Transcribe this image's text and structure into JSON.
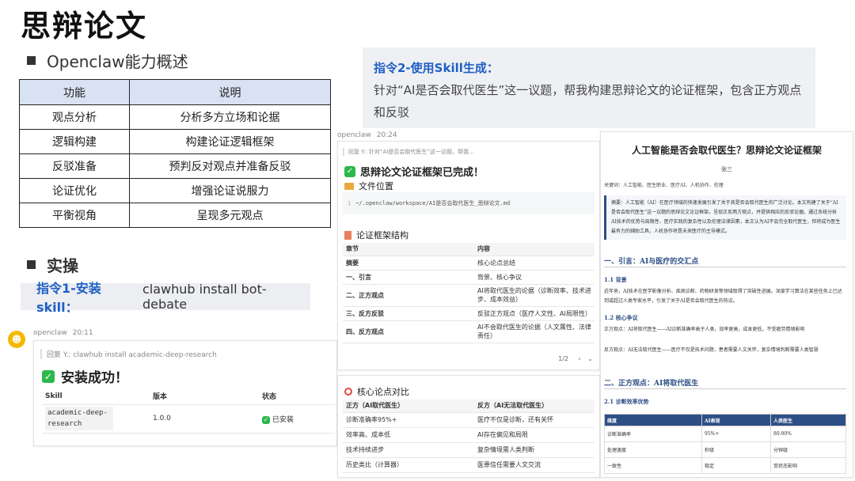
{
  "page_title": "思辩论文",
  "section1_title": "Openclaw能力概述",
  "cap_table": {
    "headers": [
      "功能",
      "说明"
    ],
    "rows": [
      [
        "观点分析",
        "分析多方立场和论据"
      ],
      [
        "逻辑构建",
        "构建论证逻辑框架"
      ],
      [
        "反驳准备",
        "预判反对观点并准备反驳"
      ],
      [
        "论证优化",
        "增强论证说服力"
      ],
      [
        "平衡视角",
        "呈现多元观点"
      ]
    ]
  },
  "section2_title": "实操",
  "cmd1": {
    "label": "指令1-安装skill：",
    "command": "clawhub install bot-debate"
  },
  "cmd2": {
    "label": "指令2-使用Skill生成：",
    "text": "针对“AI是否会取代医生”这一议题，帮我构建思辩论文的论证框架，包含正方观点和反驳"
  },
  "chat1": {
    "sender": "openclaw",
    "time": "20:11",
    "reply": "回复 Y.: clawhub install academic-deep-research",
    "success": "安装成功！",
    "headers": [
      "Skill",
      "版本",
      "状态"
    ],
    "skill": "academic-deep-research",
    "version": "1.0.0",
    "status": "已安装"
  },
  "chat2": {
    "sender": "openclaw",
    "time": "20:24",
    "reply": "回复 Y.: 针对“AI是否会取代医生”这一议题，帮我...",
    "done": "思辩论文论证框架已完成！",
    "file_heading": "文件位置",
    "line_no": "1",
    "file_path": "~/.openclaw/workspace/AI是否会取代医生_思辩论文.md",
    "struct_heading": "论证框架结构",
    "struct_headers": [
      "章节",
      "内容"
    ],
    "struct_rows": [
      [
        "摘要",
        "核心论点总结"
      ],
      [
        "一、引言",
        "背景、核心争议"
      ],
      [
        "二、正方观点",
        "AI将取代医生的论据（诊断效率、技术进步、成本效益）"
      ],
      [
        "三、反方反驳",
        "反驳正方观点（医疗人文性、AI局限性）"
      ],
      [
        "四、反方观点",
        "AI不会取代医生的论据（人文属性、法律责任）"
      ]
    ],
    "pager": "1/2",
    "compare_heading": "核心论点对比",
    "compare_headers": [
      "正方（AI取代医生）",
      "反方（AI无法取代医生）"
    ],
    "compare_rows": [
      [
        "诊断准确率95%+",
        "医疗不仅是诊断，还有关怀"
      ],
      [
        "效率高、成本低",
        "AI存在偏见和局限"
      ],
      [
        "技术持续进步",
        "复杂情境需人类判断"
      ],
      [
        "历史类比（计算器）",
        "医患信任需要人文交流"
      ]
    ]
  },
  "paper": {
    "title": "人工智能是否会取代医生？思辩论文论证框架",
    "author": "张三",
    "keywords": "关键词：人工智能、医生职业、医疗AI、人机协作、伦理",
    "abstract": "摘要：人工智能（AI）在医疗领域的快速发展引发了关于其是否会取代医生的广泛讨论。本文构建了关于“AI是否会取代医生”这一议题的思辩论文论证框架，呈现正反两方观点，并提供相应的反驳论据。通过系统分析AI技术的优势与局限性、医疗实践的复杂性以及伦理法律因素，本文认为AI不会完全取代医生，但将成为医生最有力的辅助工具，人机协作将是未来医疗的主导模式。",
    "sec1": "一、引言：AI与医疗的交汇点",
    "sub11": "1.1 背景",
    "p11": "近年来，AI技术在医学影像分析、疾病诊断、药物研发等领域取得了突破性进展。深度学习算法在某些任务上已达到或超过人类专家水平，引发了关于AI是否会取代医生的热议。",
    "sub12": "1.2 核心争议",
    "p12a": "正方观点：AI将取代医生——AI诊断准确率高于人类，效率更高，成本更低，不受疲劳情绪影响",
    "p12b": "反方观点：AI无法取代医生——医疗不仅是技术问题，患者需要人文关怀，复杂情境判断需要人类智慧",
    "sec2": "二、正方观点：AI将取代医生",
    "sub21": "2.1 诊断效率优势",
    "tbl_headers": [
      "维度",
      "AI表现",
      "人类医生"
    ],
    "tbl_rows": [
      [
        "诊断准确率",
        "95%+",
        "80-90%"
      ],
      [
        "处理速度",
        "秒级",
        "分钟级"
      ],
      [
        "一致性",
        "稳定",
        "受状态影响"
      ]
    ]
  },
  "colors": {
    "accent_blue": "#1f5fc4",
    "header_blue": "#d9e2f3",
    "success_green": "#2db84c",
    "paper_table_header": "#2e4f86"
  }
}
